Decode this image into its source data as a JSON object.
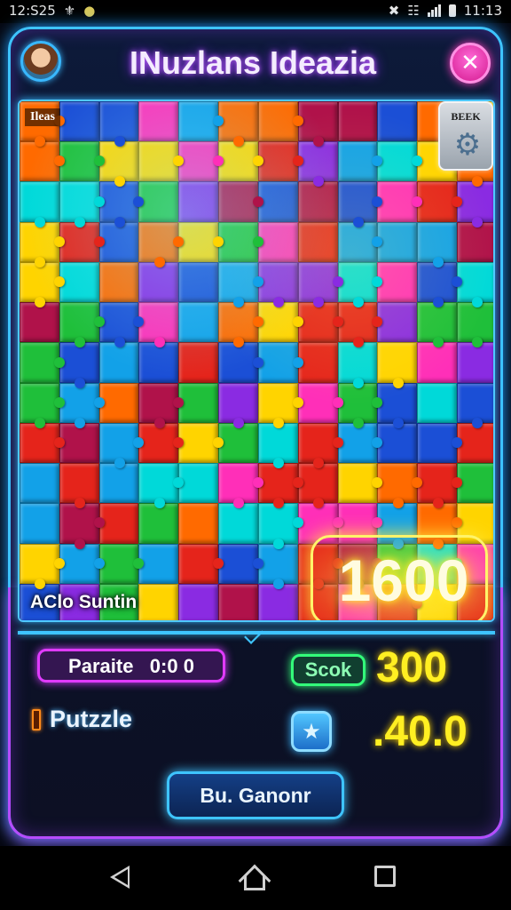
{
  "status_bar": {
    "time": "12:S25",
    "notif_icon": "&",
    "clock": "11:13"
  },
  "header": {
    "title": "INuzlans Ideazia"
  },
  "board": {
    "corner_label": "Ileas",
    "settings_label": "BEEK",
    "footer_label": "AClo Suntin",
    "big_score": "1600",
    "palette": [
      "#e5241b",
      "#ff6a00",
      "#ffd400",
      "#1fbf3a",
      "#12a1e8",
      "#1b4fd6",
      "#8a2be2",
      "#ff2fb8",
      "#00d9d9",
      "#b0124a"
    ]
  },
  "stats": {
    "paused_label": "Paraite",
    "paused_time": "0:0 0",
    "score_label": "Scok",
    "score_value": "300",
    "puzzle_label": "Putzzle",
    "puzzle_value": ".40.0"
  },
  "actions": {
    "continue_label": "Bu. Ganonr"
  },
  "colors": {
    "frame": "#3ec4ff",
    "accent_purple": "#b64cff",
    "score_yellow": "#ffef22",
    "score_green": "#33ff7a",
    "close_pink": "#ff3fc2"
  },
  "icons": {
    "close": "✕",
    "hint": "★",
    "gear": "⚙"
  }
}
